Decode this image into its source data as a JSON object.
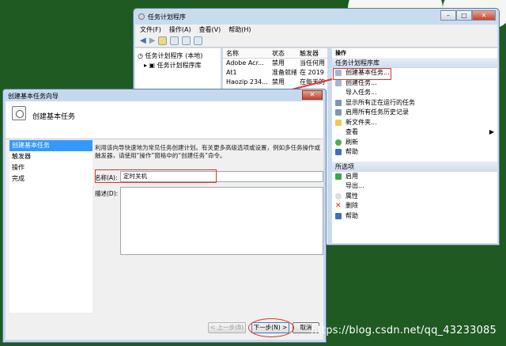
{
  "task_scheduler": {
    "title": "任务计划程序",
    "menu": [
      "文件(F)",
      "操作(A)",
      "查看(V)",
      "帮助(H)"
    ],
    "tree": [
      "任务计划程序 (本地)",
      "任务计划程序库"
    ],
    "list_headers": [
      "名称",
      "状态",
      "触发器"
    ],
    "list_rows": [
      [
        "Adobe Acr...",
        "禁用",
        "当任何用"
      ],
      [
        "At1",
        "准备就绪",
        "在 2019"
      ],
      [
        "Haozip 234...",
        "禁用",
        "在每天的"
      ]
    ],
    "actions_title": "操作",
    "section_library": "任务计划程序库",
    "library_actions": [
      "创建基本任务...",
      "创建任务...",
      "导入任务...",
      "显示所有正在运行的任务",
      "启用所有任务历史记录",
      "新文件夹...",
      "查看",
      "刷新",
      "帮助"
    ],
    "section_selected": "所选项",
    "selected_actions": [
      "启用",
      "导出...",
      "属性",
      "删除",
      "帮助"
    ]
  },
  "wizard": {
    "title": "创建基本任务向导",
    "header": "创建基本任务",
    "steps": [
      "创建基本任务",
      "触发器",
      "操作",
      "完成"
    ],
    "description_text": "利用该向导快速地为常见任务创建计划。有关更多高级选项或设置，例如多任务操作或触发器，请使用“操作”窗格中的“创建任务”命令。",
    "name_label": "名称(A):",
    "name_value": "定时关机",
    "desc_label": "描述(D):",
    "back_button": "< 上一步(B)",
    "next_button": "下一步(N) >",
    "cancel_button": "取消"
  },
  "watermark": "https://blog.csdn.net/qq_43233085",
  "colors": {
    "desktop": "#1e5a22",
    "selected_step": "#3399ff",
    "annotation": "#e0322c"
  }
}
